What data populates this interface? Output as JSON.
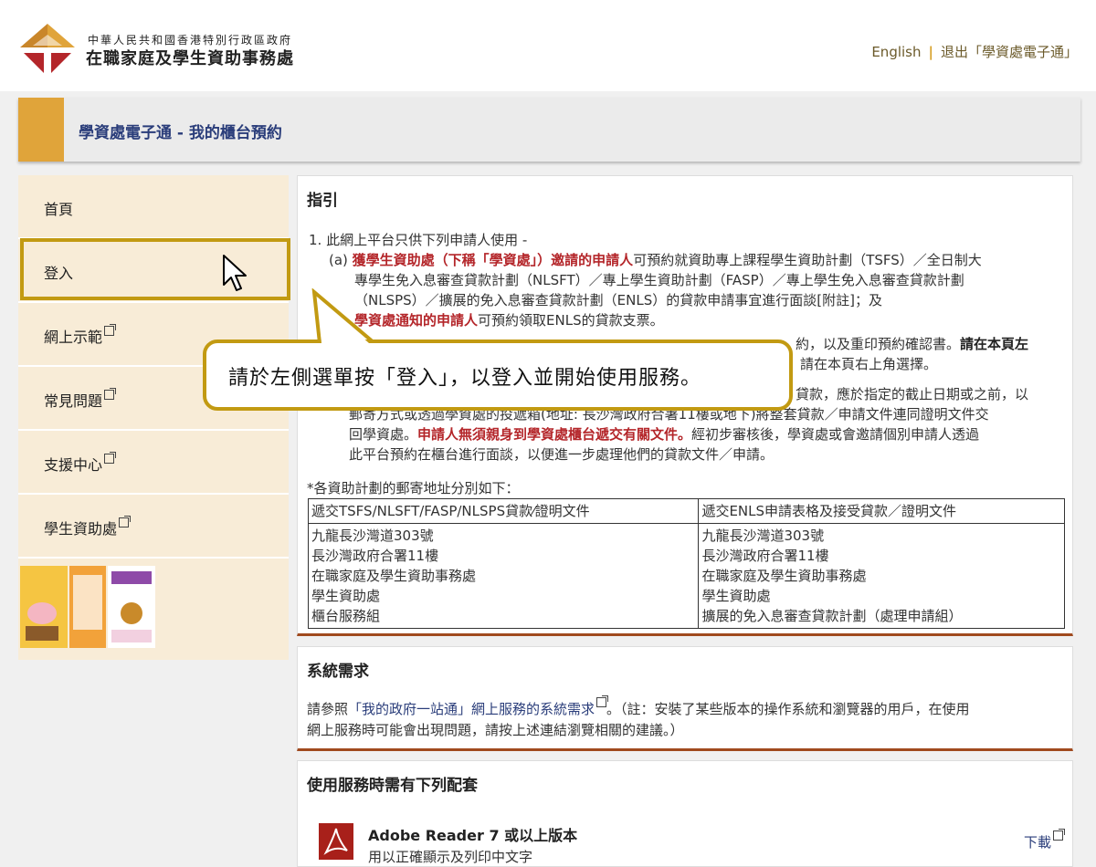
{
  "header": {
    "org_small": "中華人民共和國香港特別行政區政府",
    "org_name": "在職家庭及學生資助事務處",
    "lang_link": "English",
    "sep": "|",
    "logout_link": "退出「學資處電子通」"
  },
  "page_title": "學資處電子通 - 我的櫃台預約",
  "sidebar": {
    "items": [
      {
        "label": "首頁"
      },
      {
        "label": "登入"
      },
      {
        "label": "網上示範"
      },
      {
        "label": "常見問題"
      },
      {
        "label": "支援中心"
      },
      {
        "label": "學生資助處"
      }
    ]
  },
  "guide": {
    "title": "指引",
    "p1_intro": "1. 此網上平台只供下列申請人使用 -",
    "p1a_prefix": "(a) ",
    "p1a_red": "獲學生資助處（下稱「學資處」）邀請的申請人",
    "p1a_rest1": "可預約就資助專上課程學生資助計劃（TSFS）／全日制大",
    "p1a_rest2": "專學生免入息審查貸款計劃（NLSFT）／專上學生資助計劃（FASP）／專上學生免入息審查貸款計劃",
    "p1a_rest3": "（NLSPS）／擴展的免入息審查貸款計劃（ENLS）的貸款申請事宜進行面談[附註]；及",
    "p1b_red": "學資處通知的申請人",
    "p1b_rest": "可預約領取ENLS的貸款支票。",
    "p2_line1_rest": "約，以及重印預約確認書。",
    "p2_bold": "請在本頁左",
    "p2_line2": "請在本頁右上角選擇。",
    "p3_line1": "貸款，應於指定的截止日期或之前，以",
    "p3_line2": "郵寄方式或透過學資處的投遞箱(地址: 長沙灣政府合署11樓或地下)將整套貸款／申請文件連同證明文件交",
    "p3_line3_pre": "回學資處。",
    "p3_line3_red": "申請人無須親身到學資處櫃台遞交有關文件。",
    "p3_line3_rest": "經初步審核後，學資處或會邀請個別申請人透過",
    "p3_line4": "此平台預約在櫃台進行面談，以便進一步處理他們的貸款文件／申請。",
    "addr_intro": "*各資助計劃的郵寄地址分別如下："
  },
  "address_table": {
    "headers": [
      "遞交TSFS/NLSFT/FASP/NLSPS貸款⁄證明文件",
      "遞交ENLS申請表格及接受貸款／證明文件"
    ],
    "col1": [
      "九龍長沙灣道303號",
      "長沙灣政府合署11樓",
      "在職家庭及學生資助事務處",
      "學生資助處",
      "櫃台服務組"
    ],
    "col2": [
      "九龍長沙灣道303號",
      "長沙灣政府合署11樓",
      "在職家庭及學生資助事務處",
      "學生資助處",
      "擴展的免入息審查貸款計劃（處理申請組）"
    ]
  },
  "callout": {
    "text": "請於左側選單按「登入」，以登入並開始使用服務。"
  },
  "requirements": {
    "title": "系統需求",
    "line1_pre": "請參照",
    "line1_link": "「我的政府一站通」網上服務的系統需求",
    "line1_rest": "。（註：安裝了某些版本的操作系統和瀏覽器的用戶，在使用",
    "line2": "網上服務時可能會出現問題，請按上述連結瀏覽相關的建議。）"
  },
  "packages": {
    "title": "使用服務時需有下列配套",
    "item_title": "Adobe Reader 7 或以上版本",
    "item_desc": "用以正確顯示及列印中文字",
    "download": "下載"
  },
  "colors": {
    "accent": "#e0a43a",
    "highlight": "#c29a12",
    "link": "#2a3d7a",
    "alert": "#b4262a"
  }
}
